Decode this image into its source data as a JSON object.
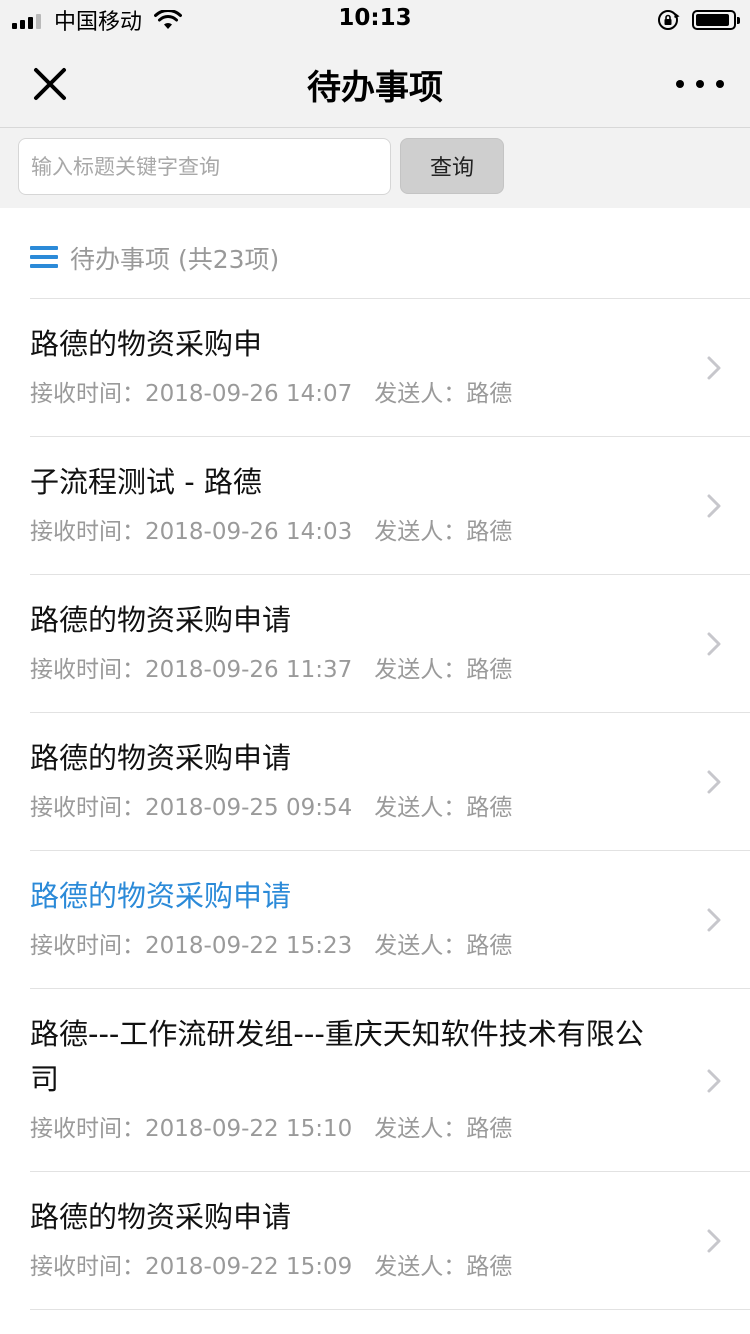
{
  "status_bar": {
    "carrier": "中国移动",
    "time": "10:13"
  },
  "nav": {
    "title": "待办事项"
  },
  "search": {
    "placeholder": "输入标题关键字查询",
    "value": "",
    "button_label": "查询"
  },
  "list_header": {
    "title": "待办事项 (共23项)"
  },
  "items": [
    {
      "title": "路德的物资采购申",
      "received_label": "接收时间：",
      "received": "2018-09-26 14:07",
      "sender_label": "发送人：",
      "sender": "路德"
    },
    {
      "title": "子流程测试 - 路德",
      "received_label": "接收时间：",
      "received": "2018-09-26 14:03",
      "sender_label": "发送人：",
      "sender": "路德"
    },
    {
      "title": "路德的物资采购申请",
      "received_label": "接收时间：",
      "received": "2018-09-26 11:37",
      "sender_label": "发送人：",
      "sender": "路德"
    },
    {
      "title": "路德的物资采购申请",
      "received_label": "接收时间：",
      "received": "2018-09-25 09:54",
      "sender_label": "发送人：",
      "sender": "路德"
    },
    {
      "title": "路德的物资采购申请",
      "received_label": "接收时间：",
      "received": "2018-09-22 15:23",
      "sender_label": "发送人：",
      "sender": "路德"
    },
    {
      "title": "路德---工作流研发组---重庆天知软件技术有限公司",
      "received_label": "接收时间：",
      "received": "2018-09-22 15:10",
      "sender_label": "发送人：",
      "sender": "路德"
    },
    {
      "title": "路德的物资采购申请",
      "received_label": "接收时间：",
      "received": "2018-09-22 15:09",
      "sender_label": "发送人：",
      "sender": "路德"
    }
  ],
  "colors": {
    "accent": "#2b8ad8",
    "bar_background": "#f2f2f2",
    "meta_text": "#9a9a9a"
  }
}
